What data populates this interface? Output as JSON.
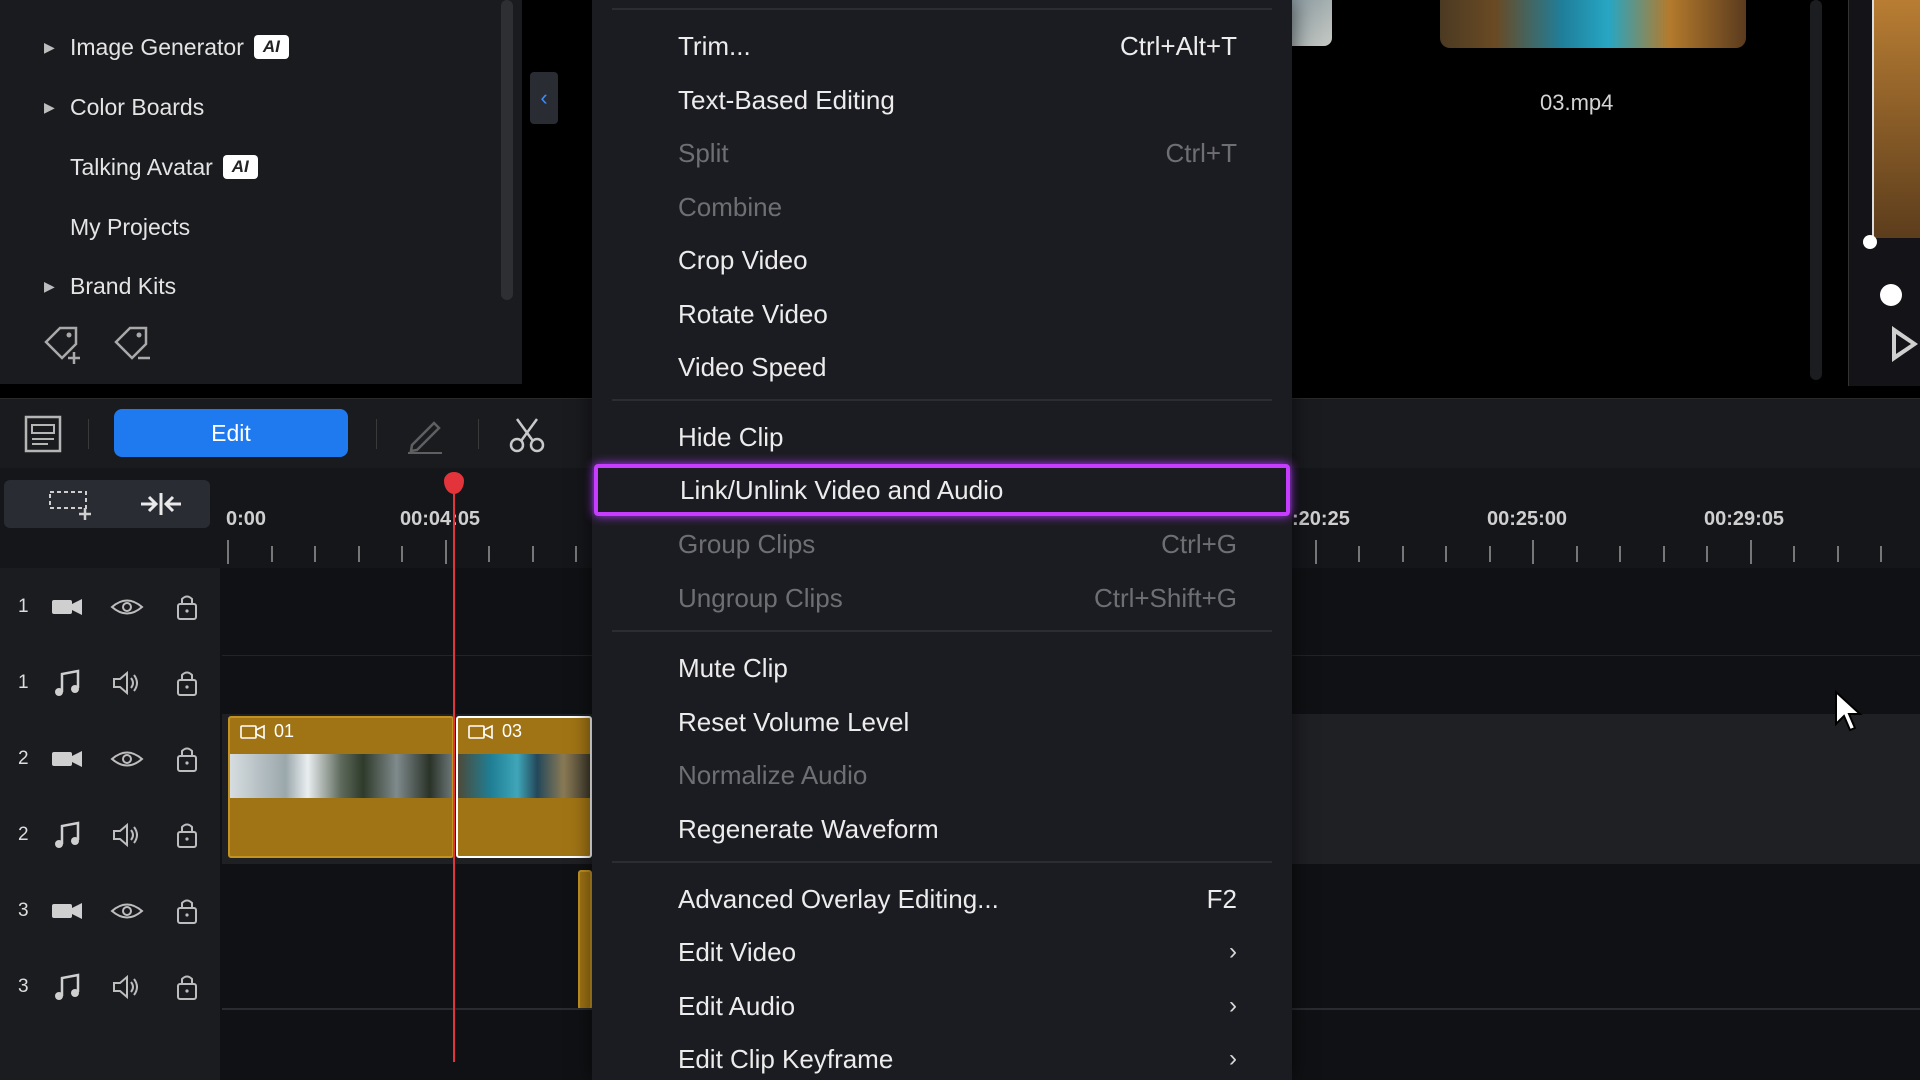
{
  "left_panel": {
    "items": [
      {
        "label": "Image Generator",
        "has_caret": true,
        "badge": "AI"
      },
      {
        "label": "Color Boards",
        "has_caret": true,
        "badge": ""
      },
      {
        "label": "Talking Avatar",
        "has_caret": false,
        "badge": "AI"
      },
      {
        "label": "My Projects",
        "has_caret": false,
        "badge": ""
      },
      {
        "label": "Brand Kits",
        "has_caret": true,
        "badge": ""
      }
    ]
  },
  "preview": {
    "clip_name": "03.mp4"
  },
  "toolbar": {
    "edit_label": "Edit"
  },
  "timeline": {
    "ruler_labels": [
      "0:00",
      "00:04:05",
      ":20:25",
      "00:25:00",
      "00:29:05"
    ],
    "tracks": [
      {
        "num": "1",
        "type": "video"
      },
      {
        "num": "1",
        "type": "audio"
      },
      {
        "num": "2",
        "type": "video"
      },
      {
        "num": "2",
        "type": "audio"
      },
      {
        "num": "3",
        "type": "video"
      },
      {
        "num": "3",
        "type": "audio"
      }
    ],
    "clips": [
      {
        "label": "01"
      },
      {
        "label": "03"
      }
    ]
  },
  "context_menu": {
    "items": [
      {
        "label": "Trim...",
        "shortcut": "Ctrl+Alt+T",
        "disabled": false
      },
      {
        "label": "Text-Based Editing",
        "shortcut": "",
        "disabled": false
      },
      {
        "label": "Split",
        "shortcut": "Ctrl+T",
        "disabled": true
      },
      {
        "label": "Combine",
        "shortcut": "",
        "disabled": true
      },
      {
        "label": "Crop Video",
        "shortcut": "",
        "disabled": false
      },
      {
        "label": "Rotate Video",
        "shortcut": "",
        "disabled": false
      },
      {
        "label": "Video Speed",
        "shortcut": "",
        "disabled": false
      },
      {
        "label": "Hide Clip",
        "shortcut": "",
        "disabled": false
      },
      {
        "label": "Link/Unlink Video and Audio",
        "shortcut": "",
        "disabled": false,
        "highlighted": true
      },
      {
        "label": "Group Clips",
        "shortcut": "Ctrl+G",
        "disabled": true
      },
      {
        "label": "Ungroup Clips",
        "shortcut": "Ctrl+Shift+G",
        "disabled": true
      },
      {
        "label": "Mute Clip",
        "shortcut": "",
        "disabled": false
      },
      {
        "label": "Reset Volume Level",
        "shortcut": "",
        "disabled": false
      },
      {
        "label": "Normalize Audio",
        "shortcut": "",
        "disabled": true
      },
      {
        "label": "Regenerate Waveform",
        "shortcut": "",
        "disabled": false
      },
      {
        "label": "Advanced Overlay Editing...",
        "shortcut": "F2",
        "disabled": false
      },
      {
        "label": "Edit Video",
        "shortcut": "",
        "disabled": false,
        "submenu": true
      },
      {
        "label": "Edit Audio",
        "shortcut": "",
        "disabled": false,
        "submenu": true
      },
      {
        "label": "Edit Clip Keyframe",
        "shortcut": "",
        "disabled": false,
        "submenu": true
      }
    ]
  },
  "colors": {
    "accent": "#1f7af0",
    "highlight_border": "#c63dff",
    "playhead": "#e3343b",
    "clip": "#a07415"
  }
}
